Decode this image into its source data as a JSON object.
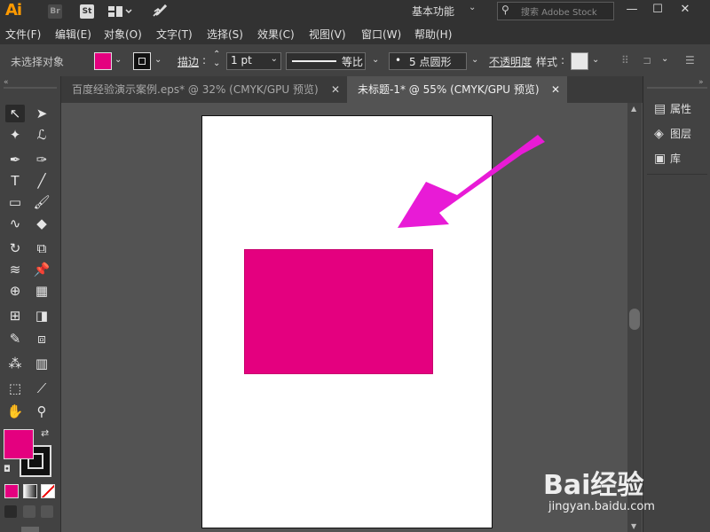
{
  "titlebar": {
    "app_logo": "Ai",
    "app_chips": [
      "Br",
      "St"
    ],
    "workspace": "基本功能",
    "search_placeholder": "搜索 Adobe Stock",
    "icons": [
      "layout-icon",
      "rocket-icon",
      "minimize-icon",
      "maximize-icon",
      "close-icon"
    ]
  },
  "menu": [
    "文件(F)",
    "编辑(E)",
    "对象(O)",
    "文字(T)",
    "选择(S)",
    "效果(C)",
    "视图(V)",
    "窗口(W)",
    "帮助(H)"
  ],
  "control": {
    "selection_status": "未选择对象",
    "stroke_label": "描边",
    "stroke_value": "1 pt",
    "stroke_profile": "等比",
    "brush": "5 点圆形",
    "opacity_label": "不透明度",
    "style_label": "样式",
    "fill_color": "#e4007f"
  },
  "tabs": [
    {
      "label": "百度经验演示案例.eps* @ 32% (CMYK/GPU 预览)",
      "active": false
    },
    {
      "label": "未标题-1* @ 55% (CMYK/GPU 预览)",
      "active": true
    }
  ],
  "panels": [
    {
      "label": "属性",
      "icon": "properties-icon"
    },
    {
      "label": "图层",
      "icon": "layers-icon"
    },
    {
      "label": "库",
      "icon": "libraries-icon"
    }
  ],
  "canvas": {
    "rectangle_color": "#e4007f",
    "arrow_color": "#e81bd6",
    "artboard_color": "#ffffff"
  },
  "watermark": {
    "main": "Bai经验",
    "sub": "jingyan.baidu.com"
  }
}
